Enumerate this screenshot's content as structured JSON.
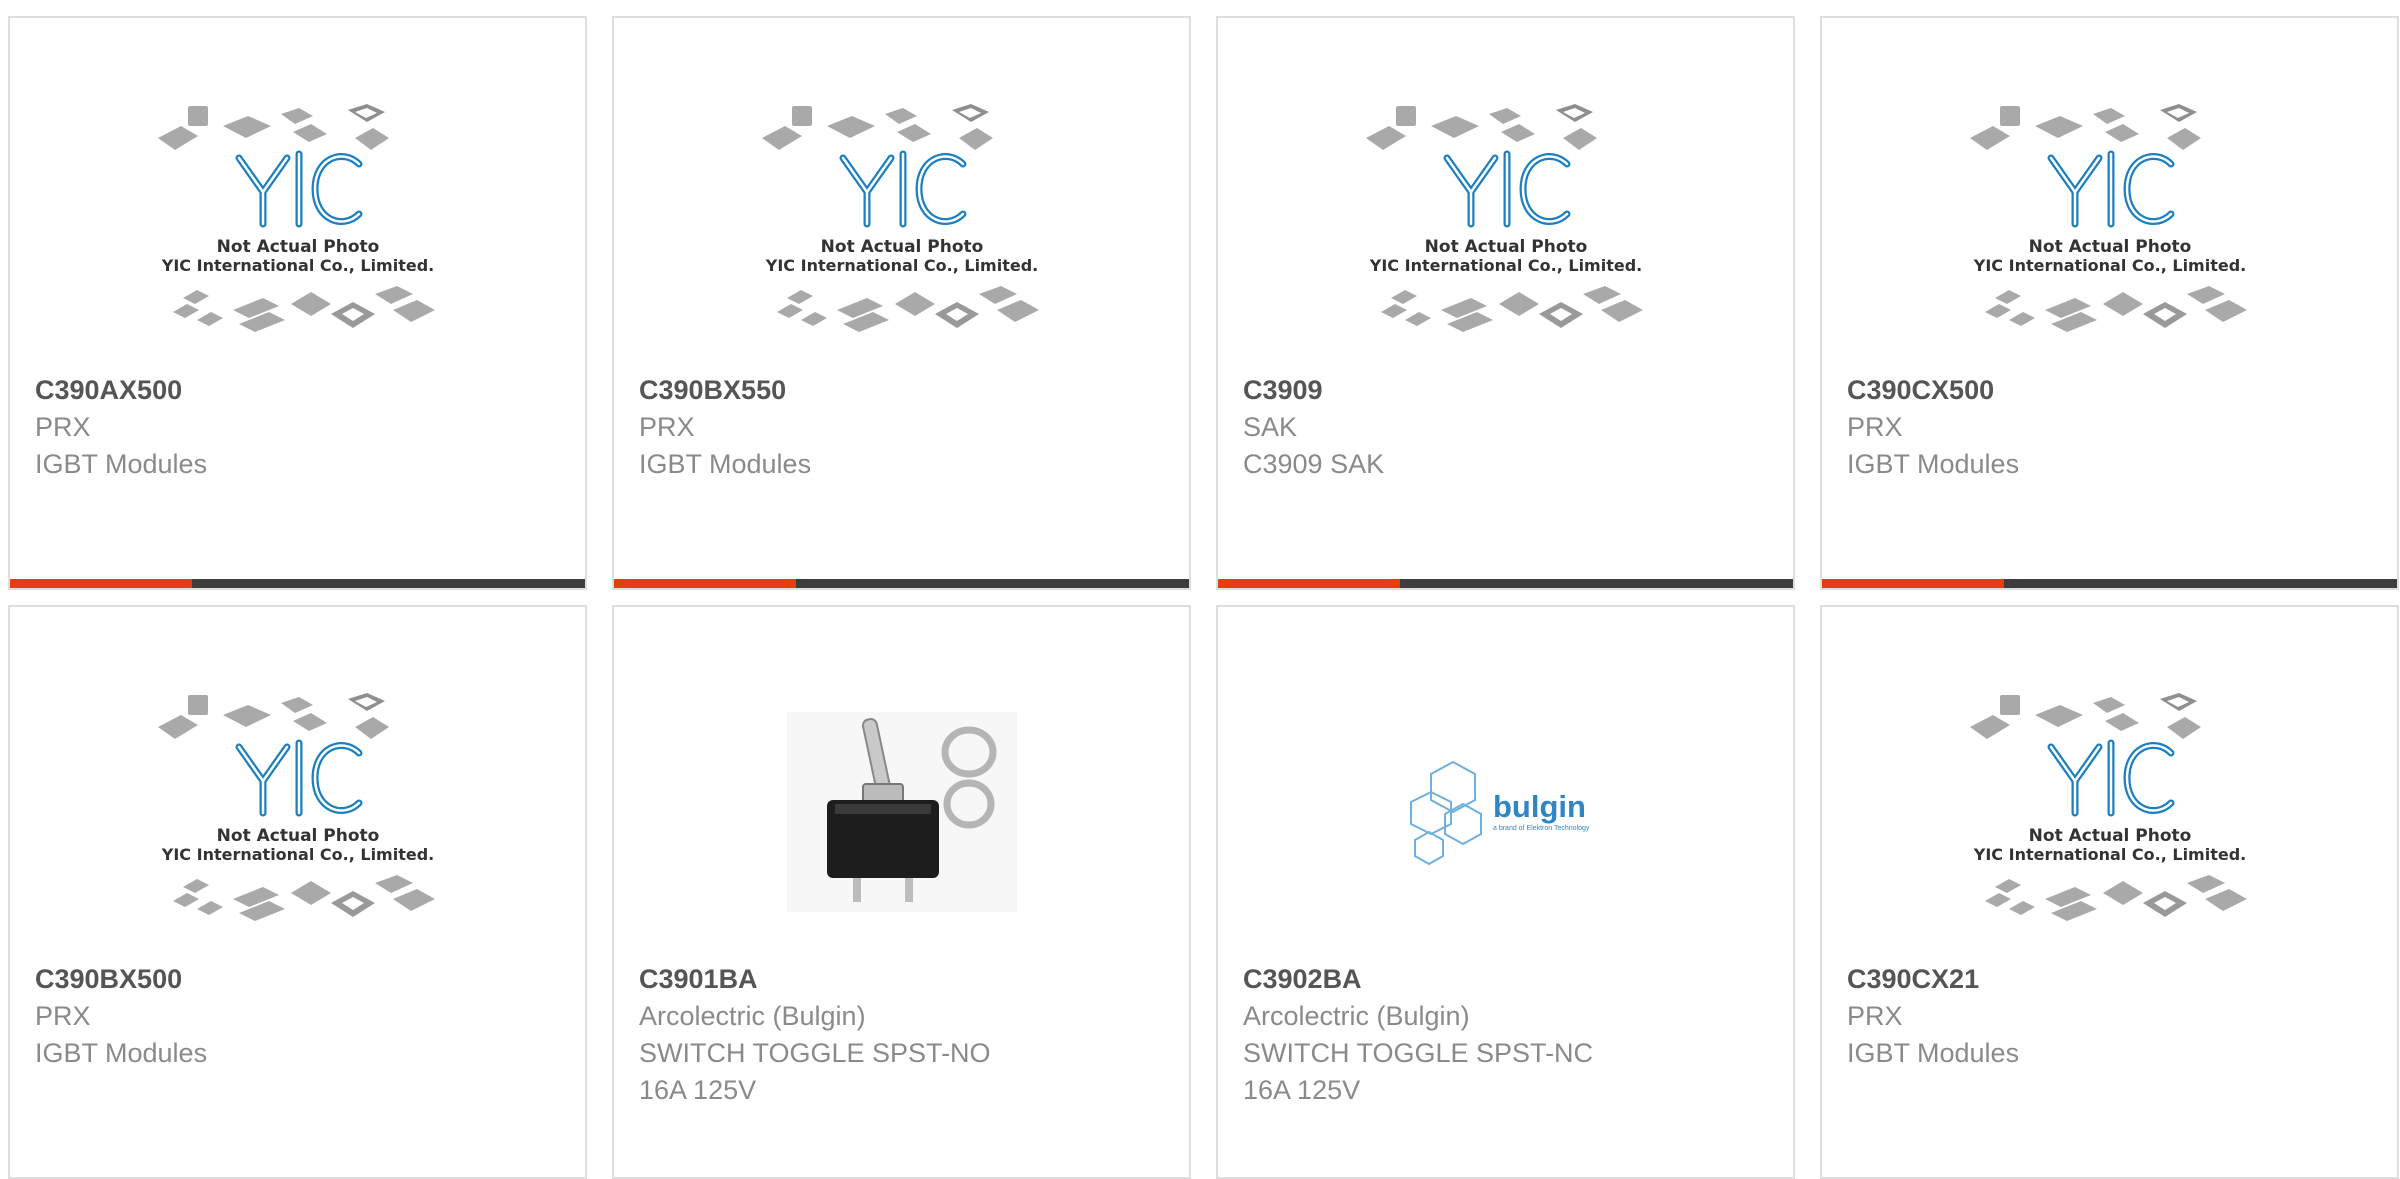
{
  "colors": {
    "accent": "#e63c10",
    "bar_dark": "#3d3d3d",
    "card_border": "#dedede",
    "part_number_text": "#555555",
    "detail_text": "#8a8a8a",
    "yic_blue": "#1b7fc0",
    "bulgin_blue": "#2f86c5"
  },
  "placeholder_image": {
    "logo_text": "YIC",
    "caption_line1": "Not Actual Photo",
    "caption_line2": "YIC International Co., Limited."
  },
  "bulgin_logo": {
    "wordmark": "bulgin",
    "tagline": "a brand of Elektron Technology"
  },
  "products": [
    {
      "part_number": "C390AX500",
      "manufacturer": "PRX",
      "description": "IGBT Modules",
      "description2": "",
      "image": "yic-placeholder-image"
    },
    {
      "part_number": "C390BX550",
      "manufacturer": "PRX",
      "description": "IGBT Modules",
      "description2": "",
      "image": "yic-placeholder-image"
    },
    {
      "part_number": "C3909",
      "manufacturer": "SAK",
      "description": "C3909 SAK",
      "description2": "",
      "image": "yic-placeholder-image"
    },
    {
      "part_number": "C390CX500",
      "manufacturer": "PRX",
      "description": "IGBT Modules",
      "description2": "",
      "image": "yic-placeholder-image"
    },
    {
      "part_number": "C390BX500",
      "manufacturer": "PRX",
      "description": "IGBT Modules",
      "description2": "",
      "image": "yic-placeholder-image"
    },
    {
      "part_number": "C3901BA",
      "manufacturer": "Arcolectric (Bulgin)",
      "description": "SWITCH TOGGLE SPST-NO",
      "description2": "16A 125V",
      "image": "toggle-switch-photo"
    },
    {
      "part_number": "C3902BA",
      "manufacturer": "Arcolectric (Bulgin)",
      "description": "SWITCH TOGGLE SPST-NC",
      "description2": "16A 125V",
      "image": "bulgin-logo-image"
    },
    {
      "part_number": "C390CX21",
      "manufacturer": "PRX",
      "description": "IGBT Modules",
      "description2": "",
      "image": "yic-placeholder-image"
    }
  ]
}
